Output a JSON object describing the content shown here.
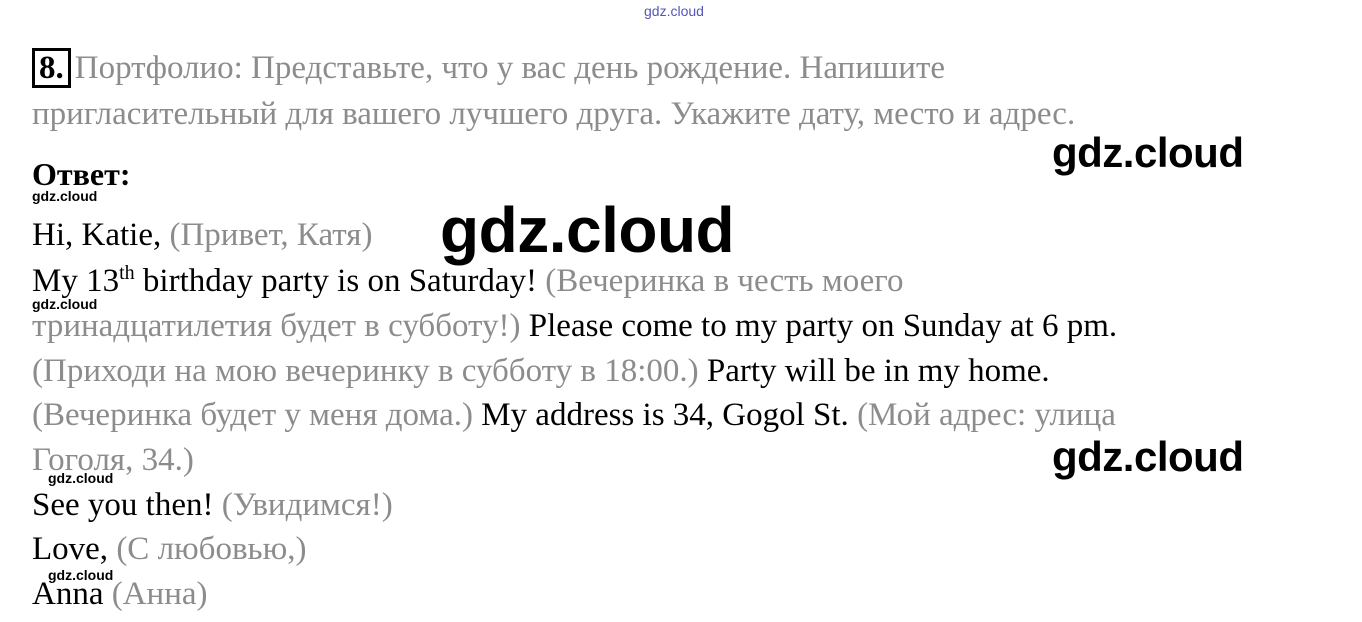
{
  "watermark": {
    "top": "gdz.cloud",
    "small": "gdz.cloud",
    "big": "gdz.cloud"
  },
  "task": {
    "number": "8.",
    "line1": "Портфолио: Представьте, что  у вас день рождение. Напишите",
    "line2": "пригласительный для вашего лучшего друга. Укажите дату, место и адрес."
  },
  "answer_label": "Ответ:",
  "letter": {
    "greeting_en": "Hi, Katie,",
    "greeting_ru": "(Привет, Катя)",
    "l2_en_a": "My 13",
    "l2_sup": "th",
    "l2_en_b": " birthday party is on Saturday!",
    "l2_ru": "(Вечеринка в честь моего",
    "l3_ru": "тринадцатилетия будет в субботу!)",
    "l3_en": "Please come to my party on Sunday at 6 pm.",
    "l4_ru": "(Приходи на мою вечеринку в субботу в 18:00.)",
    "l4_en": "Party will be in my home.",
    "l5_ru": "(Вечеринка будет у меня дома.)",
    "l5_en": "My address is 34, Gogol St.",
    "l5_ru_b": "(Мой адрес: улица",
    "l6_ru": "Гоголя, 34.)",
    "closing_en": "See you then!",
    "closing_ru": "(Увидимся!)",
    "love_en": "Love,",
    "love_ru": "(С любовью,)",
    "name_en": "Anna",
    "name_ru": "(Анна)"
  }
}
